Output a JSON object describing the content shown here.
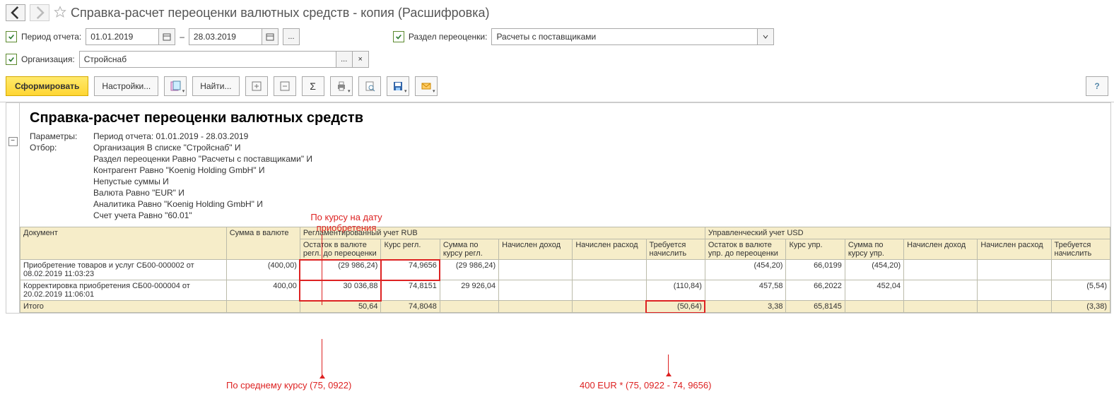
{
  "page_title": "Справка-расчет переоценки валютных средств - копия (Расшифровка)",
  "filters": {
    "period_label": "Период отчета:",
    "date_from": "01.01.2019",
    "date_to": "28.03.2019",
    "dash": "–",
    "ellipsis": "...",
    "section_label": "Раздел переоценки:",
    "section_value": "Расчеты с поставщиками",
    "org_label": "Организация:",
    "org_value": "Стройснаб",
    "clear_x": "×"
  },
  "toolbar": {
    "form": "Сформировать",
    "settings": "Настройки...",
    "find": "Найти...",
    "sigma": "Σ",
    "help": "?"
  },
  "report": {
    "title": "Справка-расчет переоценки валютных средств",
    "param_keys": {
      "params": "Параметры:",
      "filter": "Отбор:"
    },
    "param_vals": {
      "period": "Период отчета: 01.01.2019 - 28.03.2019",
      "l1": "Организация В списке \"Стройснаб\" И",
      "l2": "Раздел переоценки Равно \"Расчеты с поставщиками\" И",
      "l3": "Контрагент Равно \"Koenig Holding GmbH\" И",
      "l4": "Непустые суммы И",
      "l5": "Валюта Равно \"EUR\" И",
      "l6": "Аналитика Равно \"Koenig Holding GmbH\" И",
      "l7": "Счет учета Равно \"60.01\""
    }
  },
  "headers": {
    "doc": "Документ",
    "sum": "Сумма в валюте",
    "reg_group": "Регламентированный учет RUB",
    "reg_bal": "Остаток в валюте регл. до переоценки",
    "reg_rate": "Курс регл.",
    "reg_amt": "Сумма по курсу регл.",
    "inc": "Начислен доход",
    "exp": "Начислен расход",
    "need": "Требуется начислить",
    "mgmt_group": "Управленческий учет USD",
    "mgmt_bal": "Остаток в валюте упр. до переоценки",
    "mgmt_rate": "Курс упр.",
    "mgmt_amt": "Сумма по курсу упр.",
    "minc": "Начислен доход",
    "mexp": "Начислен расход",
    "mneed": "Требуется начислить"
  },
  "rows": [
    {
      "doc": "Приобретение товаров и услуг СБ00-000002 от 08.02.2019 11:03:23",
      "sum": "(400,00)",
      "rbal": "(29 986,24)",
      "rrate": "74,9656",
      "ramt": "(29 986,24)",
      "inc": "",
      "exp": "",
      "need": "",
      "mbal": "(454,20)",
      "mrate": "66,0199",
      "mamt": "(454,20)",
      "minc": "",
      "mexp": "",
      "mneed": ""
    },
    {
      "doc": "Корректировка приобретения СБ00-000004 от 20.02.2019 11:06:01",
      "sum": "400,00",
      "rbal": "30 036,88",
      "rrate": "74,8151",
      "ramt": "29 926,04",
      "inc": "",
      "exp": "",
      "need": "(110,84)",
      "mbal": "457,58",
      "mrate": "66,2022",
      "mamt": "452,04",
      "minc": "",
      "mexp": "",
      "mneed": "(5,54)"
    }
  ],
  "total": {
    "label": "Итого",
    "rbal": "50,64",
    "rrate": "74,8048",
    "need": "(50,64)",
    "mbal": "3,38",
    "mrate": "65,8145",
    "mneed": "(3,38)"
  },
  "annotations": {
    "top": "По курсу на дату приобретения",
    "bottom_left": "По среднему курсу (75, 0922)",
    "bottom_right": "400 EUR * (75, 0922 - 74, 9656)"
  }
}
